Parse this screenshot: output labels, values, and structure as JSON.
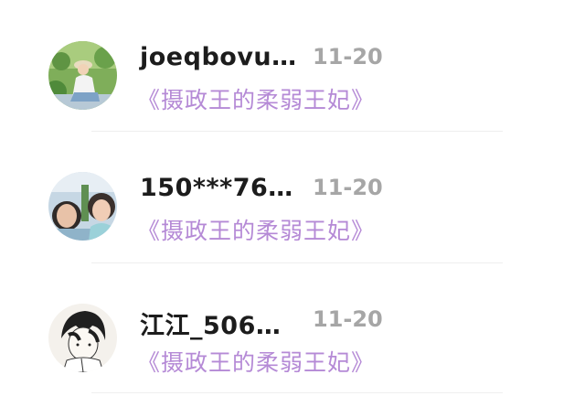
{
  "comments": [
    {
      "username": "joeqbovu…",
      "date": "11-20",
      "book_title": "《摄政王的柔弱王妃》",
      "avatar_icon": "avatar-photo-girl-in-garden"
    },
    {
      "username": "150***76…",
      "date": "11-20",
      "book_title": "《摄政王的柔弱王妃》",
      "avatar_icon": "avatar-photo-two-girls"
    },
    {
      "username": "江江_506…",
      "date": "11-20",
      "book_title": "《摄政王的柔弱王妃》",
      "avatar_icon": "avatar-anime-sketch"
    }
  ],
  "colors": {
    "username": "#1c1c1c",
    "date": "#a6a6a6",
    "book_title": "#b58ad6",
    "divider": "#efefef"
  }
}
